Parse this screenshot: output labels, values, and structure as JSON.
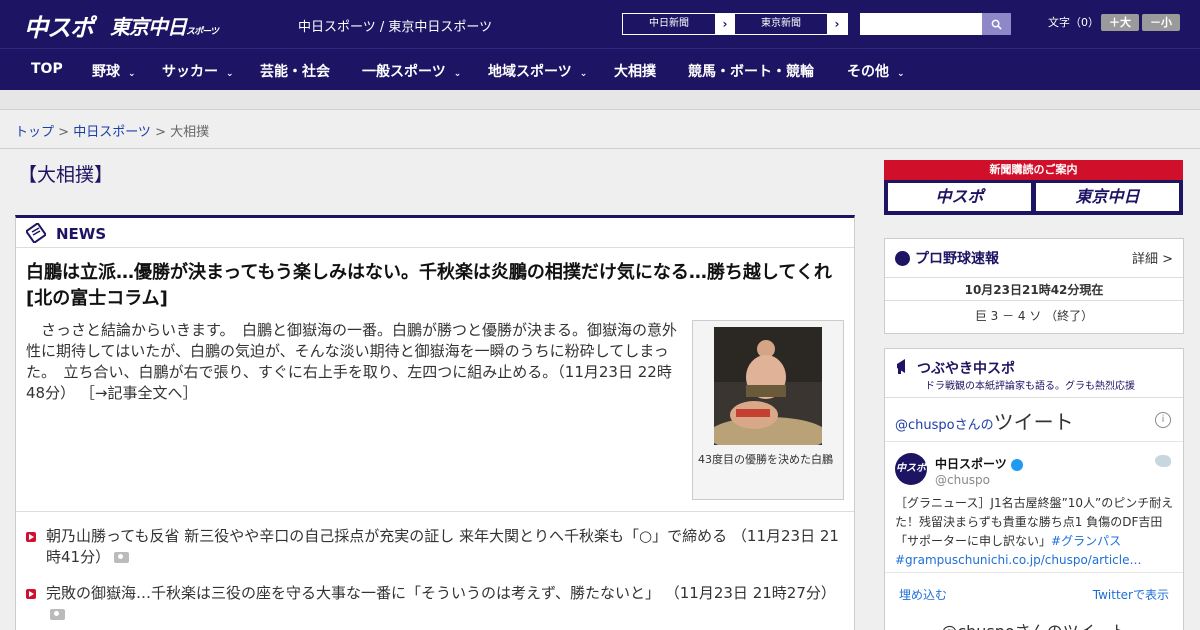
{
  "header": {
    "logo1": "中スポ",
    "logo2": "東京中日",
    "logo2_small": "スポーツ",
    "site_title": "中日スポーツ / 東京中日スポーツ",
    "ext_links": [
      {
        "label": "中日新聞",
        "arrow": "›"
      },
      {
        "label": "東京新聞",
        "arrow": "›"
      }
    ],
    "search_placeholder": "",
    "font_size_label": "文字（0）",
    "font_plus": "＋大",
    "font_minus": "－小"
  },
  "nav": {
    "items": [
      {
        "label": "TOP",
        "chev": ""
      },
      {
        "label": "野球",
        "chev": "⌄"
      },
      {
        "label": "サッカー",
        "chev": "⌄"
      },
      {
        "label": "芸能・社会",
        "chev": ""
      },
      {
        "label": "一般スポーツ",
        "chev": "⌄"
      },
      {
        "label": "地域スポーツ",
        "chev": "⌄"
      },
      {
        "label": "大相撲",
        "chev": ""
      },
      {
        "label": "競馬・ボート・競輪",
        "chev": ""
      },
      {
        "label": "その他",
        "chev": "⌄"
      }
    ]
  },
  "breadcrumb": {
    "top": "トップ",
    "sep1": " > ",
    "parent": "中日スポーツ",
    "sep2": " > ",
    "current": "大相撲"
  },
  "section_title": "【大相撲】",
  "news": {
    "label": "NEWS",
    "headline": "白鵬は立派…優勝が決まってもう楽しみはない。千秋楽は炎鵬の相撲だけ気になる…勝ち越してくれ[北の富士コラム]",
    "body": "　さっさと結論からいきます。　白鵬と御嶽海の一番。白鵬が勝つと優勝が決まる。御嶽海の意外性に期待してはいたが、白鵬の気迫が、そんな淡い期待と御嶽海を一瞬のうちに粉砕してしまった。　立ち合い、白鵬が右で張り、すぐに右上手を取り、左四つに組み止める。（11月23日 22時48分）",
    "more": "［→記事全文へ］",
    "photo_caption": "43度目の優勝を決めた白鵬",
    "items": [
      {
        "text": "朝乃山勝っても反省 新三役やや辛口の自己採点が充実の証し 来年大関とりへ千秋楽も「○」で締める",
        "time": "（11月23日 21時41分）"
      },
      {
        "text": "完敗の御嶽海…千秋楽は三役の座を守る大事な一番に「そういうのは考えず、勝たないと」",
        "time": "（11月23日 21時27分）"
      }
    ]
  },
  "subscribe": {
    "title": "新聞購読のご案内",
    "btn1": "中スポ",
    "btn2": "東京中日"
  },
  "baseball": {
    "title": "プロ野球速報",
    "detail": "詳細 >",
    "time": "10月23日21時42分現在",
    "game": "巨 3 － 4 ソ （終了）"
  },
  "twitter": {
    "title": "つぶやき中スポ",
    "subtitle": "ドラ戦観の本紙評論家も語る。グラも熱烈応援",
    "header_handle": "@chuspo",
    "header_no": "さんの",
    "header_big": "ツイート",
    "info": "i",
    "avatar_text": "中スポ",
    "name": "中日スポーツ",
    "handle": "@chuspo",
    "text": "［グラニュース］J1名古屋終盤”10人”のピンチ耐えた！残留決まらずも貴重な勝ち点1 負傷のDF吉田「サポーターに申し訳ない」",
    "tags": "#グランパス #grampuschunichi.co.jp/chuspo/article…",
    "embed": "埋め込む",
    "view": "Twitterで表示",
    "footer": "@chuspoさんのツイート"
  },
  "colors": {
    "brand": "#1d1463",
    "accent": "#d0102a",
    "link": "#1c3ea8"
  }
}
